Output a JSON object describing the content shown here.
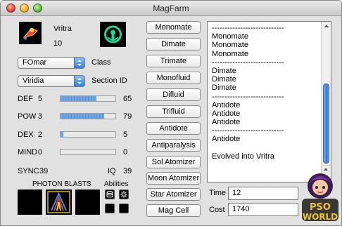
{
  "window": {
    "title": "MagFarm"
  },
  "mag": {
    "name": "Vritra",
    "level": "10"
  },
  "class": {
    "label": "Class",
    "selected": "FOmar"
  },
  "section_id": {
    "label": "Section ID",
    "selected": "Viridia"
  },
  "stats": [
    {
      "label": "DEF",
      "level": "5",
      "value": "65",
      "progress": 0.65
    },
    {
      "label": "POW",
      "level": "3",
      "value": "79",
      "progress": 0.79
    },
    {
      "label": "DEX",
      "level": "2",
      "value": "5",
      "progress": 0.05
    },
    {
      "label": "MIND",
      "level": "0",
      "value": "0",
      "progress": 0.0
    }
  ],
  "sync": {
    "label": "SYNC",
    "value": "39"
  },
  "iq": {
    "label": "IQ",
    "value": "39"
  },
  "photon_blasts": {
    "label": "PHOTON BLASTS"
  },
  "abilities": {
    "label": "Abilities"
  },
  "items": [
    "Monomate",
    "Dimate",
    "Trimate",
    "Monofluid",
    "Difluid",
    "Trifluid",
    "Antidote",
    "Antiparalysis",
    "Sol Atomizer",
    "Moon Atomizer",
    "Star Atomizer",
    "Mag Cell"
  ],
  "log": [
    "----------------------------",
    "Monomate",
    "Monomate",
    "Monomate",
    "----------------------------",
    "Dimate",
    "Dimate",
    "Dimate",
    "----------------------------",
    "Antidote",
    "Antidote",
    "Antidote",
    "----------------------------",
    "Antidote",
    "",
    "Evolved into Vritra"
  ],
  "time": {
    "label": "Time",
    "value": "12"
  },
  "cost": {
    "label": "Cost",
    "value": "1740"
  },
  "logo": {
    "line1": "PSO",
    "line2": "WORLD"
  },
  "colors": {
    "bar_fill": "#5b98e0",
    "scroll_thumb": "#2f78d6"
  },
  "icons": {
    "mag_icon": "mag-vritra-icon",
    "section_icon": "viridia-section-icon"
  }
}
